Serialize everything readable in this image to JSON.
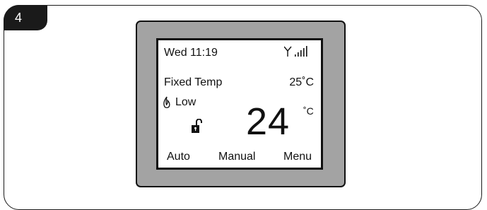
{
  "step_number": "4",
  "status_bar": {
    "datetime": "Wed  11:19",
    "signal_icon": "antenna-signal-icon"
  },
  "mode_label": "Fixed Temp",
  "setpoint": "25˚C",
  "flame_level": "Low",
  "lock_icon": "unlocked-padlock-icon",
  "current_temp": {
    "value": "24",
    "unit": "˚C"
  },
  "softkeys": {
    "left": "Auto",
    "center": "Manual",
    "right": "Menu"
  },
  "colors": {
    "bezel": "#a3a3a3",
    "outline": "#111111",
    "screen": "#ffffff"
  }
}
